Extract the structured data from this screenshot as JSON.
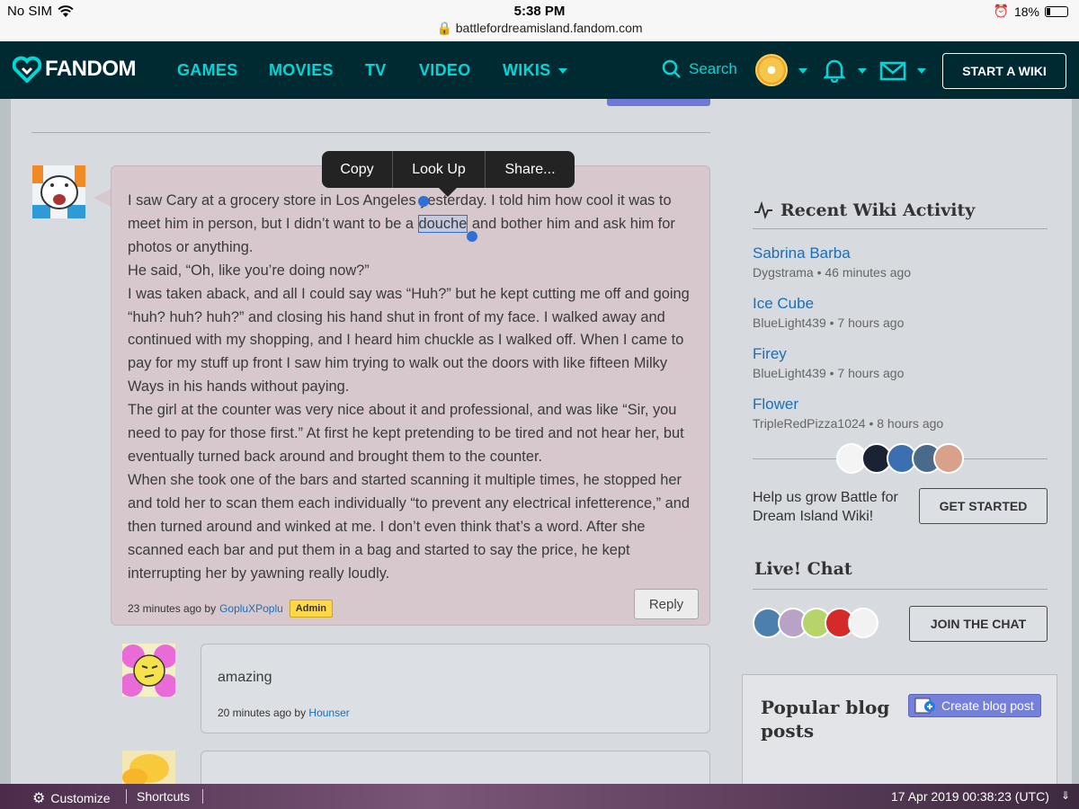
{
  "status_bar": {
    "carrier": "No SIM",
    "time": "5:38 PM",
    "url": "battlefordreamisland.fandom.com",
    "battery": "18%"
  },
  "nav": {
    "logo": "FANDOM",
    "links": [
      "GAMES",
      "MOVIES",
      "TV",
      "VIDEO",
      "WIKIS"
    ],
    "search_label": "Search",
    "start_wiki": "START A WIKI",
    "accent_color": "#00d6d6",
    "bg_color": "#002a32"
  },
  "context_menu": {
    "items": [
      "Copy",
      "Look Up",
      "Share..."
    ]
  },
  "comment": {
    "paragraphs": [
      {
        "before": "I saw Cary at a grocery store in Los Angeles yesterday. I told him how cool it was to meet him in person, but I didn’t want to be a ",
        "selected": "douche",
        "after": " and bother him and ask him for photos or anything."
      },
      {
        "text": "He said, “Oh, like you’re doing now?”"
      },
      {
        "text": "I was taken aback, and all I could say was “Huh?” but he kept cutting me off and going “huh? huh? huh?” and closing his hand shut in front of my face. I walked away and continued with my shopping, and I heard him chuckle as I walked off. When I came to pay for my stuff up front I saw him trying to walk out the doors with like fifteen Milky Ways in his hands without paying."
      },
      {
        "text": "The girl at the counter was very nice about it and professional, and was like “Sir, you need to pay for those first.” At first he kept pretending to be tired and not hear her, but eventually turned back around and brought them to the counter."
      },
      {
        "text": "When she took one of the bars and started scanning it multiple times, he stopped her and told her to scan them each individually “to prevent any electrical infetterence,” and then turned around and winked at me. I don’t even think that’s a word. After she scanned each bar and put them in a bag and started to say the price, he kept interrupting her by yawning really loudly."
      }
    ],
    "time": "23 minutes ago by",
    "author": "GopluXPoplu",
    "badge": "Admin",
    "reply_label": "Reply"
  },
  "replies": [
    {
      "text": "amazing",
      "time": "20 minutes ago by",
      "author": "Hounser"
    }
  ],
  "recent_activity": {
    "title": "Recent Wiki Activity",
    "items": [
      {
        "title": "Sabrina Barba",
        "sub": "Dygstrama • 46 minutes ago"
      },
      {
        "title": "Ice Cube",
        "sub": "BlueLight439 • 7 hours ago"
      },
      {
        "title": "Firey",
        "sub": "BlueLight439 • 7 hours ago"
      },
      {
        "title": "Flower",
        "sub": "TripleRedPizza1024 • 8 hours ago"
      }
    ]
  },
  "grow": {
    "text": "Help us grow Battle for Dream Island Wiki!",
    "button": "GET STARTED"
  },
  "chat": {
    "title": "Live! Chat",
    "button": "JOIN THE CHAT"
  },
  "blog": {
    "title": "Popular blog posts",
    "button": "Create blog post"
  },
  "toolbar": {
    "customize": "Customize",
    "shortcuts": "Shortcuts",
    "datetime": "17 Apr 2019 00:38:23 (UTC)"
  }
}
